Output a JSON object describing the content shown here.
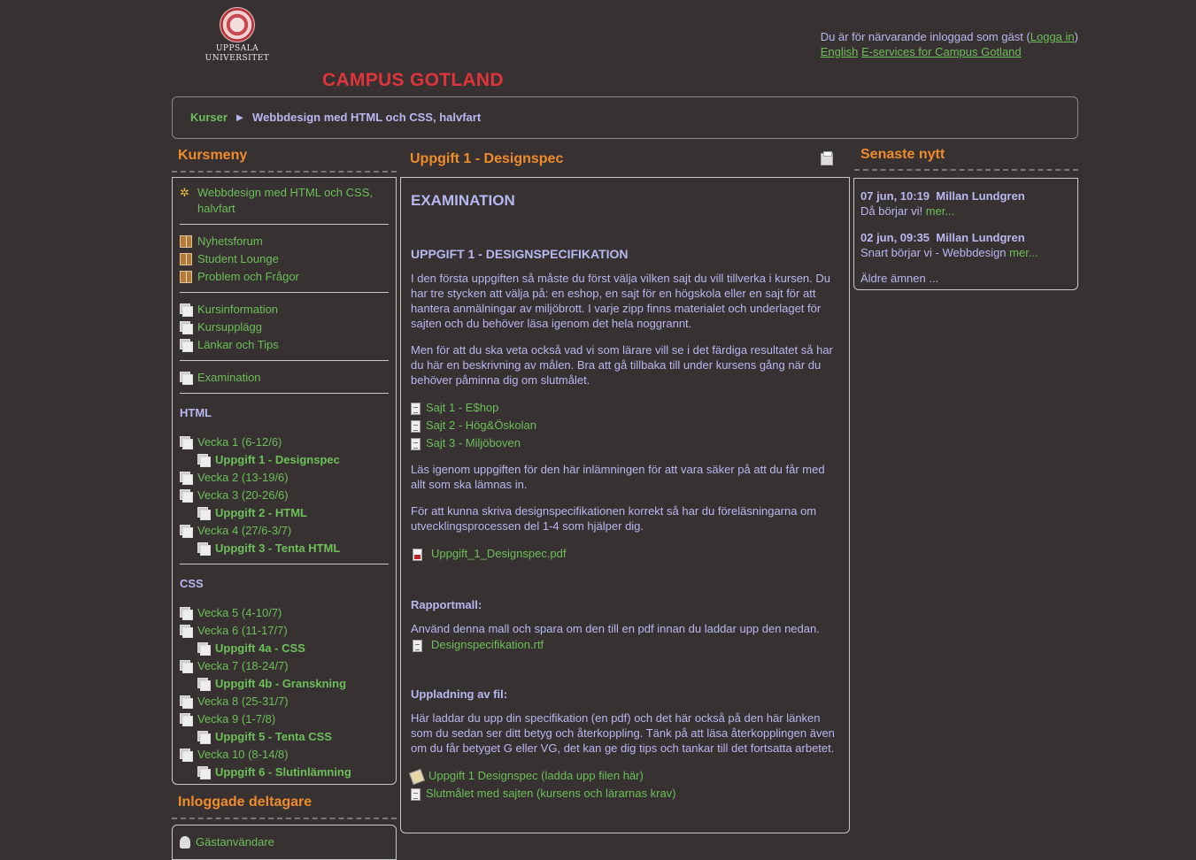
{
  "header": {
    "logo_line1": "UPPSALA",
    "logo_line2": "UNIVERSITET",
    "site_title": "CAMPUS GOTLAND",
    "login_prefix": "Du är för närvarande inloggad som gäst (",
    "login_link": "Logga in",
    "login_suffix": ")",
    "lang_link": "English",
    "eservices_link": "E-services for Campus Gotland"
  },
  "breadcrumb": {
    "root": "Kurser",
    "separator": "►",
    "current": "Webbdesign med HTML och CSS, halvfart"
  },
  "kursmeny": {
    "title": "Kursmeny",
    "course_link": "Webbdesign med HTML och CSS, halvfart",
    "group1": [
      "Nyhetsforum",
      "Student Lounge",
      "Problem och Frågor"
    ],
    "group2": [
      "Kursinformation",
      "Kursupplägg",
      "Länkar och Tips"
    ],
    "group3": [
      "Examination"
    ],
    "html_label": "HTML",
    "html_items": [
      {
        "label": "Vecka 1 (6-12/6)",
        "sub": false
      },
      {
        "label": "Uppgift 1 - Designspec",
        "sub": true
      },
      {
        "label": "Vecka 2 (13-19/6)",
        "sub": false
      },
      {
        "label": "Vecka 3 (20-26/6)",
        "sub": false
      },
      {
        "label": "Uppgift 2 - HTML",
        "sub": true
      },
      {
        "label": "Vecka 4 (27/6-3/7)",
        "sub": false
      },
      {
        "label": "Uppgift 3 - Tenta HTML",
        "sub": true
      }
    ],
    "css_label": "CSS",
    "css_items": [
      {
        "label": "Vecka 5 (4-10/7)",
        "sub": false
      },
      {
        "label": "Vecka 6 (11-17/7)",
        "sub": false
      },
      {
        "label": "Uppgift 4a - CSS",
        "sub": true
      },
      {
        "label": "Vecka 7 (18-24/7)",
        "sub": false
      },
      {
        "label": "Uppgift 4b - Granskning",
        "sub": true
      },
      {
        "label": "Vecka 8 (25-31/7)",
        "sub": false
      },
      {
        "label": "Vecka 9 (1-7/8)",
        "sub": false
      },
      {
        "label": "Uppgift 5 - Tenta CSS",
        "sub": true
      },
      {
        "label": "Vecka 10 (8-14/8)",
        "sub": false
      },
      {
        "label": "Uppgift 6 - Slutinlämning",
        "sub": true
      }
    ]
  },
  "online": {
    "title": "Inloggade deltagare",
    "user": "Gästanvändare"
  },
  "main": {
    "page_title": "Uppgift 1 - Designspec",
    "heading": "EXAMINATION",
    "subheading": "UPPGIFT 1 - DESIGNSPECIFIKATION",
    "para1": "I den första uppgiften så måste du först välja vilken sajt du vill tillverka i kursen. Du har tre stycken att välja på: en eshop, en sajt för en högskola eller en sajt för att hantera anmälningar av miljöbrott. I varje zipp finns materialet och underlaget för sajten och du behöver läsa igenom det hela noggrannt.",
    "para2": "Men för att du ska veta också vad vi som lärare vill se i det färdiga resultatet så har du här en beskrivning av målen. Bra att gå tillbaka till under kursens gång när du behöver påminna dig om slutmålet.",
    "sites": [
      "Sajt 1 - E$hop",
      "Sajt 2 - Hög&Öskolan",
      "Sajt 3 - Miljöboven"
    ],
    "para3": "Läs igenom uppgiften för den här inlämningen för att vara säker på att du får med allt som ska lämnas in.",
    "para4": "För att kunna skriva designspecifikationen korrekt så har du föreläsningarna om utvecklingsprocessen del 1-4 som hjälper dig.",
    "pdf_link": "Uppgift_1_Designspec.pdf",
    "rapport_label": "Rapportmall:",
    "rapport_text": "Använd denna mall och spara om den till en pdf innan du laddar upp den nedan.",
    "rtf_link": "Designspecifikation.rtf",
    "upload_label": "Uppladning av fil:",
    "upload_text": "Här laddar du upp din specifikation (en pdf) och det här också på den här länken som du sedan ser ditt betyg och återkoppling. Tänk på att läsa återkopplingen även om du får betyget G eller VG, det kan ge dig tips och tankar till det fortsatta arbetet.",
    "upload_link": "Uppgift 1 Designspec (ladda upp filen här)",
    "goal_link": "Slutmålet med sajten (kursens och lärarnas krav)"
  },
  "news": {
    "title": "Senaste nytt",
    "items": [
      {
        "date": "07 jun, 10:19",
        "author": "Millan Lundgren",
        "text": "Då börjar vi!",
        "more": "mer..."
      },
      {
        "date": "02 jun, 09:35",
        "author": "Millan Lundgren",
        "text": "Snart börjar vi - Webbdesign",
        "more": "mer..."
      }
    ],
    "older": "Äldre ämnen ..."
  }
}
